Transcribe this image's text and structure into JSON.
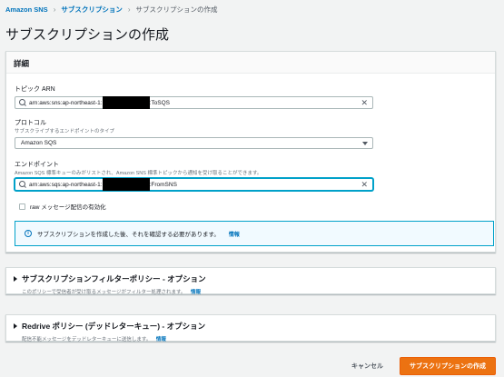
{
  "breadcrumb": {
    "items": [
      "Amazon SNS",
      "サブスクリプション",
      "サブスクリプションの作成"
    ]
  },
  "page_title": "サブスクリプションの作成",
  "details": {
    "header": "詳細",
    "topic_arn": {
      "label": "トピック ARN",
      "value_prefix": "arn:aws:sns:ap-northeast-1:",
      "value_suffix": ":ToSQS"
    },
    "protocol": {
      "label": "プロトコル",
      "description": "サブスクライブするエンドポイントのタイプ",
      "selected": "Amazon SQS"
    },
    "endpoint": {
      "label": "エンドポイント",
      "description": "Amazon SQS 標準キューのみがリストされ、Amazon SNS 標準トピックから通知を受け取ることができます。",
      "value_prefix": "arn:aws:sqs:ap-northeast-1:",
      "value_suffix": ":FromSNS"
    },
    "raw_delivery_label": "raw メッセージ配信の有効化",
    "info_text": "サブスクリプションを作成した後、それを確認する必要があります。",
    "info_link": "情報"
  },
  "filter_policy": {
    "title": "サブスクリプションフィルターポリシー - オプション",
    "description": "このポリシーで受信者が受け取るメッセージがフィルター処理されます。",
    "link": "情報"
  },
  "redrive_policy": {
    "title": "Redrive ポリシー (デッドレターキュー) - オプション",
    "description": "配信不能メッセージをデッドレターキューに送信します。",
    "link": "情報"
  },
  "actions": {
    "cancel": "キャンセル",
    "create": "サブスクリプションの作成"
  },
  "colors": {
    "primary_button": "#ec7211",
    "link": "#0073bb",
    "focus": "#00a1c9"
  }
}
